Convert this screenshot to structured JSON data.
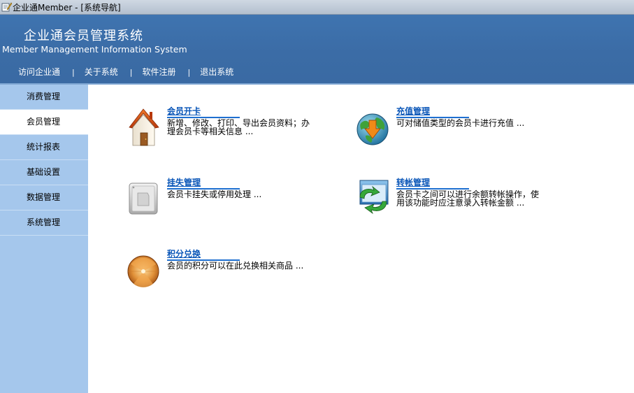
{
  "window": {
    "title": "企业通Member - [系统导航]"
  },
  "header": {
    "title_cn": "企业通会员管理系统",
    "title_en": "Member Management Information System",
    "nav": [
      {
        "label": "访问企业通"
      },
      {
        "label": "关于系统"
      },
      {
        "label": "软件注册"
      },
      {
        "label": "退出系统"
      }
    ],
    "separator": "|"
  },
  "sidebar": {
    "items": [
      {
        "label": "消费管理",
        "active": false
      },
      {
        "label": "会员管理",
        "active": true
      },
      {
        "label": "统计报表",
        "active": false
      },
      {
        "label": "基础设置",
        "active": false
      },
      {
        "label": "数据管理",
        "active": false
      },
      {
        "label": "系统管理",
        "active": false
      }
    ]
  },
  "main": {
    "cards": [
      {
        "icon": "house-icon",
        "title": "会员开卡",
        "desc": "新增、修改、打印、导出会员资料；办理会员卡等相关信息 ..."
      },
      {
        "icon": "globe-download-icon",
        "title": "充值管理",
        "desc": "可对储值类型的会员卡进行充值 ..."
      },
      {
        "icon": "card-lock-icon",
        "title": "挂失管理",
        "desc": "会员卡挂失或停用处理 ..."
      },
      {
        "icon": "transfer-icon",
        "title": "转帐管理",
        "desc": "会员卡之间可以进行余额转帐操作，使用该功能时应注意录入转帐金额 ..."
      },
      {
        "icon": "points-exchange-icon",
        "title": "积分兑换",
        "desc": "会员的积分可以在此兑换相关商品 ..."
      }
    ]
  },
  "colors": {
    "header_blue": "#3b6ca6",
    "sidebar_blue": "#a5c7ec",
    "link_blue": "#0a56b8"
  }
}
